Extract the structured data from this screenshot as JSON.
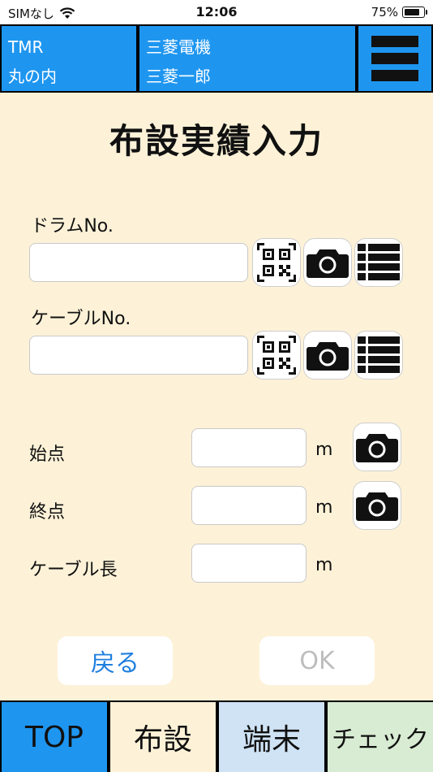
{
  "status_bar": {
    "carrier": "SIMなし",
    "time": "12:06",
    "battery": "75%"
  },
  "header": {
    "code": "TMR",
    "location": "丸の内",
    "company": "三菱電機",
    "user": "三菱一郎"
  },
  "page_title": "布設実績入力",
  "drum": {
    "label": "ドラムNo.",
    "value": ""
  },
  "cable": {
    "label": "ケーブルNo.",
    "value": ""
  },
  "start": {
    "label": "始点",
    "value": "",
    "unit": "m"
  },
  "end": {
    "label": "終点",
    "value": "",
    "unit": "m"
  },
  "length": {
    "label": "ケーブル長",
    "value": "",
    "unit": "m"
  },
  "buttons": {
    "back": "戻る",
    "ok": "OK"
  },
  "tabs": [
    {
      "label": "TOP"
    },
    {
      "label": "布設"
    },
    {
      "label": "端末"
    },
    {
      "label": "チェック"
    }
  ],
  "colors": {
    "accent": "#1e96f0",
    "background": "#fdf2d8",
    "back_text": "#1e7fe0",
    "disabled_text": "#bdbdbd"
  }
}
